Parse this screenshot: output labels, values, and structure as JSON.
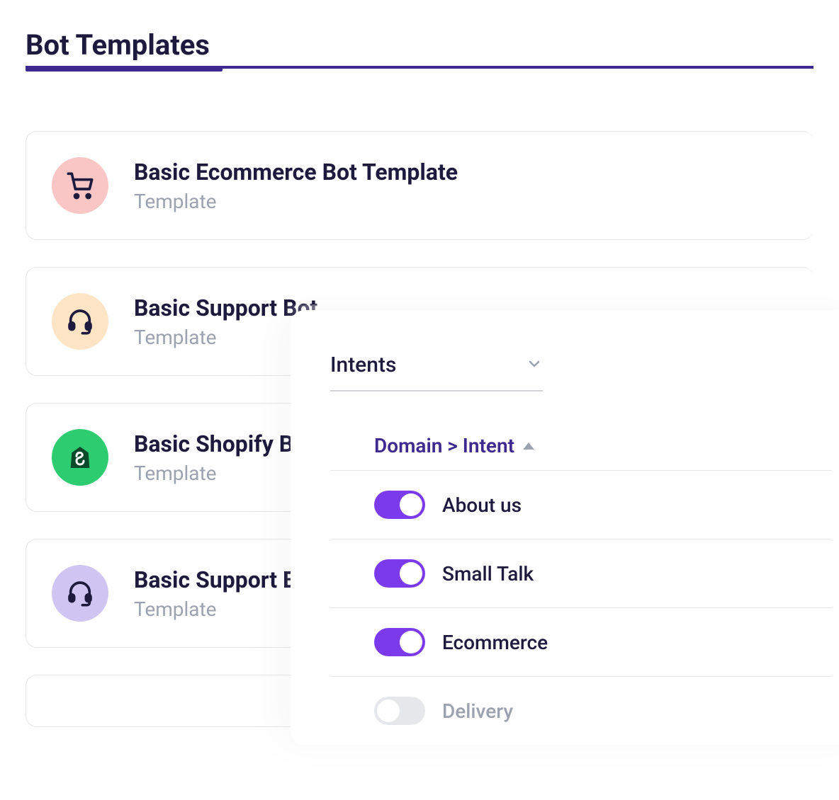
{
  "page": {
    "title": "Bot Templates"
  },
  "templates": [
    {
      "title": "Basic Ecommerce Bot Template",
      "subtitle": "Template",
      "icon": "cart",
      "color": "pink"
    },
    {
      "title": "Basic Support Bot",
      "subtitle": "Template",
      "icon": "headset",
      "color": "peach"
    },
    {
      "title": "Basic Shopify Bot",
      "subtitle": "Template",
      "icon": "shopify",
      "color": "green"
    },
    {
      "title": "Basic Support Bot",
      "subtitle": "Template",
      "icon": "headset",
      "color": "lavender"
    }
  ],
  "intents_panel": {
    "dropdown_label": "Intents",
    "column_header": "Domain > Intent",
    "rows": [
      {
        "label": "About us",
        "enabled": true
      },
      {
        "label": "Small Talk",
        "enabled": true
      },
      {
        "label": "Ecommerce",
        "enabled": true
      },
      {
        "label": "Delivery",
        "enabled": false
      }
    ]
  }
}
